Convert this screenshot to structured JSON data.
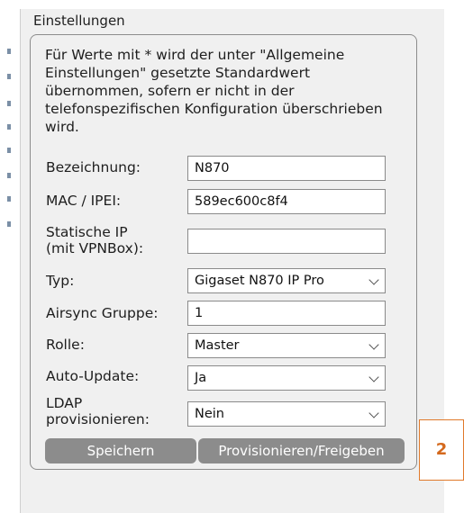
{
  "panel": {
    "title": "Einstellungen"
  },
  "note": "Für Werte mit * wird der unter \"Allgemeine Einstellungen\" gesetzte Standardwert übernommen, sofern er nicht in der telefonspezifischen Konfiguration überschrieben wird.",
  "fields": {
    "bezeichnung": {
      "label": "Bezeichnung:",
      "value": "N870"
    },
    "mac": {
      "label": "MAC / IPEI:",
      "value": "589ec600c8f4"
    },
    "static_ip": {
      "label_line1": "Statische IP",
      "label_line2": "(mit VPNBox):",
      "value": ""
    },
    "typ": {
      "label": "Typ:",
      "value": "Gigaset N870 IP Pro"
    },
    "airsync": {
      "label": "Airsync Gruppe:",
      "value": "1"
    },
    "rolle": {
      "label": "Rolle:",
      "value": "Master"
    },
    "auto_update": {
      "label": "Auto-Update:",
      "value": "Ja"
    },
    "ldap": {
      "label_line1": "LDAP",
      "label_line2": "provisionieren:",
      "value": "Nein"
    }
  },
  "buttons": {
    "save": "Speichern",
    "provision": "Provisionieren/Freigeben"
  },
  "badge": "2",
  "colors": {
    "button_bg": "#8c8c8c",
    "badge_border": "#e0792a",
    "panel_bg": "#f0f0f0"
  }
}
